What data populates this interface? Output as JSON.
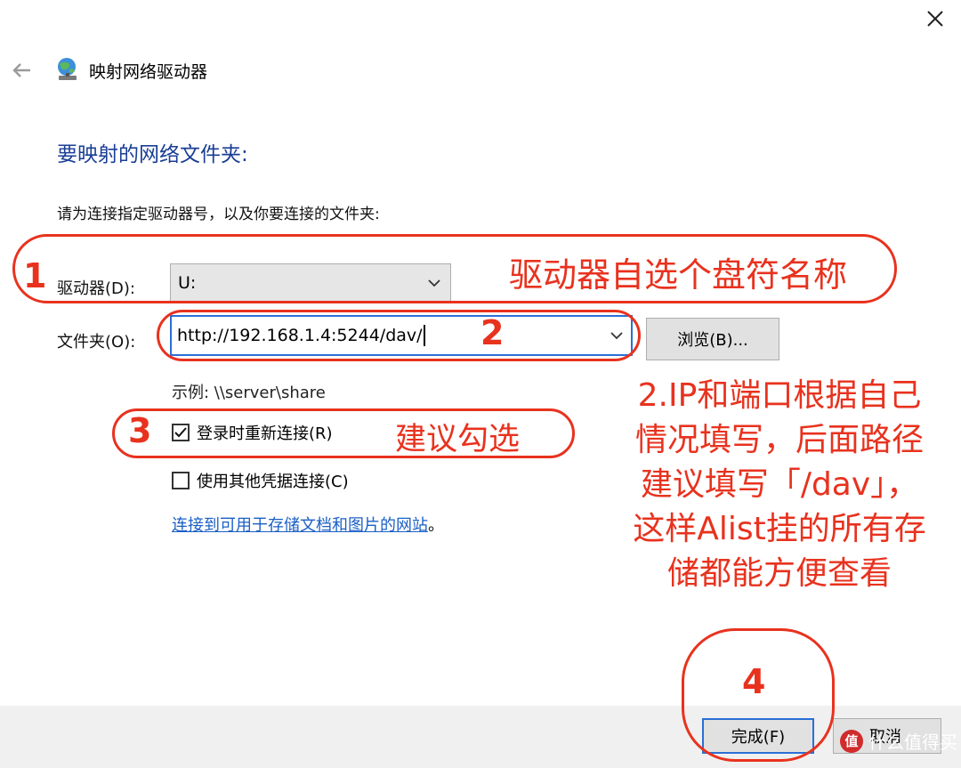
{
  "window": {
    "title": "映射网络驱动器"
  },
  "icons": {
    "back": "back-arrow-icon",
    "app": "network-drive-icon",
    "close": "close-icon"
  },
  "page": {
    "heading": "要映射的网络文件夹:",
    "instruction": "请为连接指定驱动器号，以及你要连接的文件夹:"
  },
  "form": {
    "drive_label": "驱动器(D):",
    "drive_value": "U:",
    "folder_label": "文件夹(O):",
    "folder_value": "http://192.168.1.4:5244/dav/",
    "browse_label": "浏览(B)...",
    "example": "示例: \\\\server\\share",
    "reconnect_label": "登录时重新连接(R)",
    "reconnect_checked": true,
    "other_cred_label": "使用其他凭据连接(C)",
    "other_cred_checked": false,
    "link_text": "连接到可用于存储文档和图片的网站",
    "link_suffix": "。"
  },
  "footer": {
    "finish_label": "完成(F)",
    "cancel_label": "取消"
  },
  "annotations": {
    "num1": "1",
    "num2": "2",
    "num3": "3",
    "num4": "4",
    "note1": "驱动器自选个盘符名称",
    "note3": "建议勾选",
    "note2_lines": [
      "2.IP和端口根据自己",
      "情况填写，后面路径",
      "建议填写「/dav」，",
      "这样Alist挂的所有存",
      "储都能方便查看"
    ],
    "color": "#e8321e"
  },
  "watermark": {
    "badge": "值",
    "text": "什么值得买"
  },
  "colors": {
    "heading": "#1a3e96",
    "accent": "#2a6fd6",
    "link": "#1a5fc6"
  }
}
